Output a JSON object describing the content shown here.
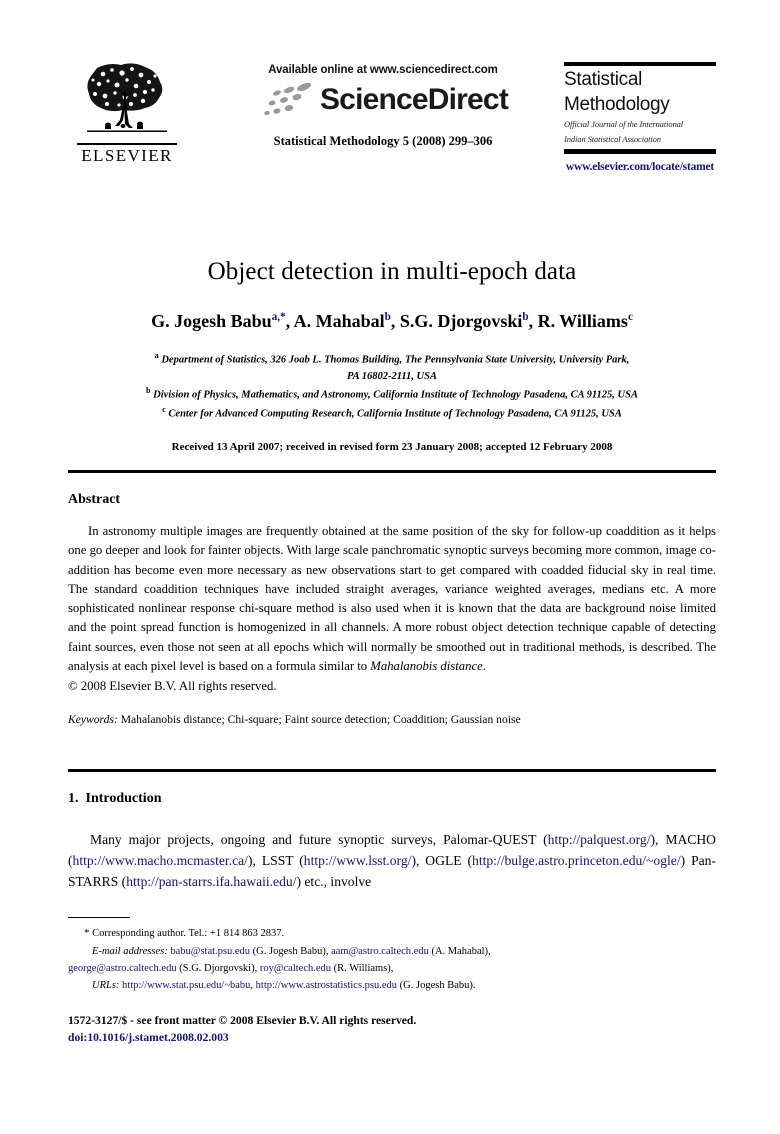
{
  "masthead": {
    "publisher_name": "ELSEVIER",
    "publisher_logo_icon": "elsevier-tree-icon",
    "available_online": "Available online at www.sciencedirect.com",
    "sciencedirect_wordmark": "ScienceDirect",
    "sciencedirect_swoosh_icon": "sciencedirect-swoosh-icon",
    "citation": "Statistical Methodology 5 (2008) 299–306",
    "journal_title_line1": "Statistical",
    "journal_title_line2": "Methodology",
    "journal_subtitle_line1": "Official Journal of the International",
    "journal_subtitle_line2": "Indian Statistical Association",
    "journal_url": "www.elsevier.com/locate/stamet"
  },
  "article": {
    "title": "Object detection in multi-epoch data",
    "authors": [
      {
        "name": "G. Jogesh Babu",
        "sup": "a,*"
      },
      {
        "name": "A. Mahabal",
        "sup": "b"
      },
      {
        "name": "S.G. Djorgovski",
        "sup": "b"
      },
      {
        "name": "R. Williams",
        "sup": "c"
      }
    ],
    "affiliations": [
      {
        "mark": "a",
        "line1": "Department of Statistics, 326 Joab L. Thomas Building, The Pennsylvania State University, University Park,",
        "line2": "PA 16802-2111, USA"
      },
      {
        "mark": "b",
        "line1": "Division of Physics, Mathematics, and Astronomy, California Institute of Technology Pasadena, CA 91125, USA",
        "line2": ""
      },
      {
        "mark": "c",
        "line1": "Center for Advanced Computing Research, California Institute of Technology Pasadena, CA 91125, USA",
        "line2": ""
      }
    ],
    "received": "Received 13 April 2007; received in revised form 23 January 2008; accepted 12 February 2008"
  },
  "abstract": {
    "heading": "Abstract",
    "text_part1": "In astronomy multiple images are frequently obtained at the same position of the sky for follow-up coaddition as it helps one go deeper and look for fainter objects. With large scale panchromatic synoptic surveys becoming more common, image co-addition has become even more necessary as new observations start to get compared with coadded fiducial sky in real time. The standard coaddition techniques have included straight averages, variance weighted averages, medians etc. A more sophisticated nonlinear response chi-square method is also used when it is known that the data are background noise limited and the point spread function is homogenized in all channels. A more robust object detection technique capable of detecting faint sources, even those not seen at all epochs which will normally be smoothed out in traditional methods, is described. The analysis at each pixel level is based on a formula similar to ",
    "text_italic": "Mahalanobis distance",
    "text_part2": ".",
    "copyright": "© 2008 Elsevier B.V. All rights reserved.",
    "keywords_label": "Keywords:",
    "keywords_value": "Mahalanobis distance; Chi-square; Faint source detection; Coaddition; Gaussian noise"
  },
  "introduction": {
    "number": "1.",
    "heading": "Introduction",
    "text_seg1": "Many major projects, ongoing and future synoptic surveys, Palomar-QUEST (",
    "url1": "http://palquest.org/",
    "text_seg2": "), MACHO (",
    "url2": "http://www.macho.mcmaster.ca/",
    "text_seg3": "), LSST (",
    "url3": "http://www.lsst.org/",
    "text_seg4": "), OGLE (",
    "url4": "http://bulge.astro.princeton.edu/~ogle/",
    "text_seg5": ") Pan-STARRS (",
    "url5": "http://pan-starrs.ifa.hawaii.edu/",
    "text_seg6": ") etc., involve"
  },
  "footnotes": {
    "corresponding": "Corresponding author. Tel.: +1 814 863 2837.",
    "corresponding_mark": "*",
    "email_label": "E-mail addresses:",
    "emails": [
      {
        "address": "babu@stat.psu.edu",
        "person": " (G. Jogesh Babu), "
      },
      {
        "address": "aam@astro.caltech.edu",
        "person": " (A. Mahabal),"
      },
      {
        "address": "george@astro.caltech.edu",
        "person": " (S.G. Djorgovski), "
      },
      {
        "address": "roy@caltech.edu",
        "person": " (R. Williams),"
      }
    ],
    "urls_label": "URLs:",
    "urls": [
      {
        "address": "http://www.stat.psu.edu/~babu",
        "sep": ", "
      },
      {
        "address": "http://www.astrostatistics.psu.edu",
        "sep": ""
      }
    ],
    "urls_person": " (G. Jogesh Babu)."
  },
  "footer": {
    "issn_line": "1572-3127/$ - see front matter © 2008 Elsevier B.V. All rights reserved.",
    "doi": "doi:10.1016/j.stamet.2008.02.003"
  },
  "colors": {
    "link": "#15156b",
    "text": "#000000",
    "background": "#ffffff"
  }
}
